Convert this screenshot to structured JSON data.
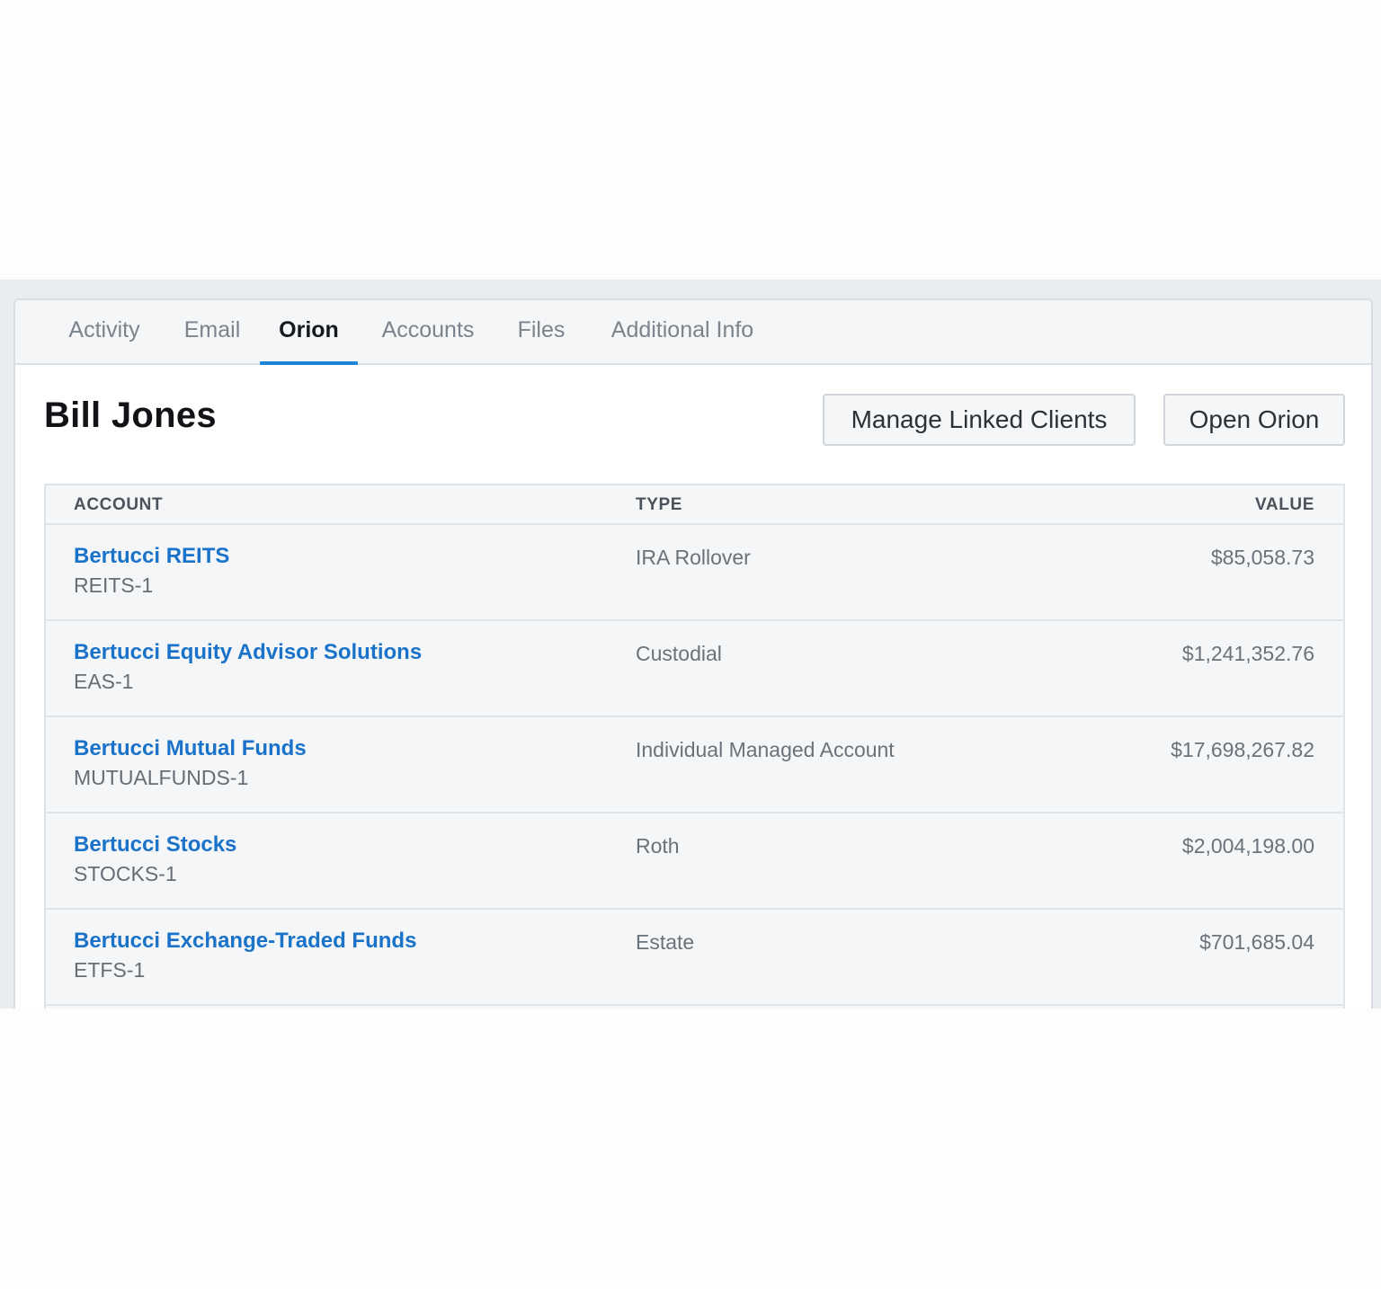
{
  "tabs": [
    {
      "label": "Activity",
      "active": false
    },
    {
      "label": "Email",
      "active": false
    },
    {
      "label": "Orion",
      "active": true
    },
    {
      "label": "Accounts",
      "active": false
    },
    {
      "label": "Files",
      "active": false
    },
    {
      "label": "Additional Info",
      "active": false
    }
  ],
  "header": {
    "title": "Bill Jones",
    "manage_linked_clients_label": "Manage Linked Clients",
    "open_orion_label": "Open Orion"
  },
  "table": {
    "columns": {
      "account": "ACCOUNT",
      "type": "TYPE",
      "value": "VALUE"
    },
    "rows": [
      {
        "name": "Bertucci REITS",
        "code": "REITS-1",
        "type": "IRA Rollover",
        "value": "$85,058.73"
      },
      {
        "name": "Bertucci Equity Advisor Solutions",
        "code": "EAS-1",
        "type": "Custodial",
        "value": "$1,241,352.76"
      },
      {
        "name": "Bertucci Mutual Funds",
        "code": "MUTUALFUNDS-1",
        "type": "Individual Managed Account",
        "value": "$17,698,267.82"
      },
      {
        "name": "Bertucci Stocks",
        "code": "STOCKS-1",
        "type": "Roth",
        "value": "$2,004,198.00"
      },
      {
        "name": "Bertucci Exchange-Traded Funds",
        "code": "ETFS-1",
        "type": "Estate",
        "value": "$701,685.04"
      }
    ]
  },
  "colors": {
    "accent": "#1f84d6",
    "link": "#1a72c9"
  }
}
